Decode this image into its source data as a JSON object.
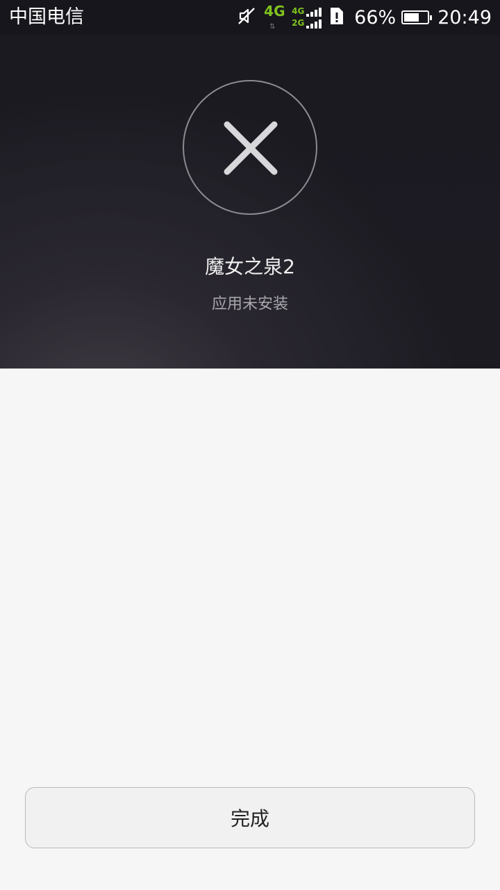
{
  "status_bar": {
    "carrier": "中国电信",
    "network_primary": "4G",
    "network_dual_top": "4G",
    "network_dual_bottom": "2G",
    "battery_percent": "66%",
    "battery_level": 0.66,
    "time": "20:49",
    "icons": [
      "mute-icon",
      "sim-alert-icon",
      "signal-bars-icon",
      "battery-icon"
    ]
  },
  "result": {
    "status_icon": "close-icon",
    "app_name": "魔女之泉2",
    "message": "应用未安装"
  },
  "footer": {
    "done_label": "完成"
  },
  "colors": {
    "network_green": "#7fc31f",
    "header_dark": "#1b1a21",
    "page_bg": "#f6f6f6"
  }
}
